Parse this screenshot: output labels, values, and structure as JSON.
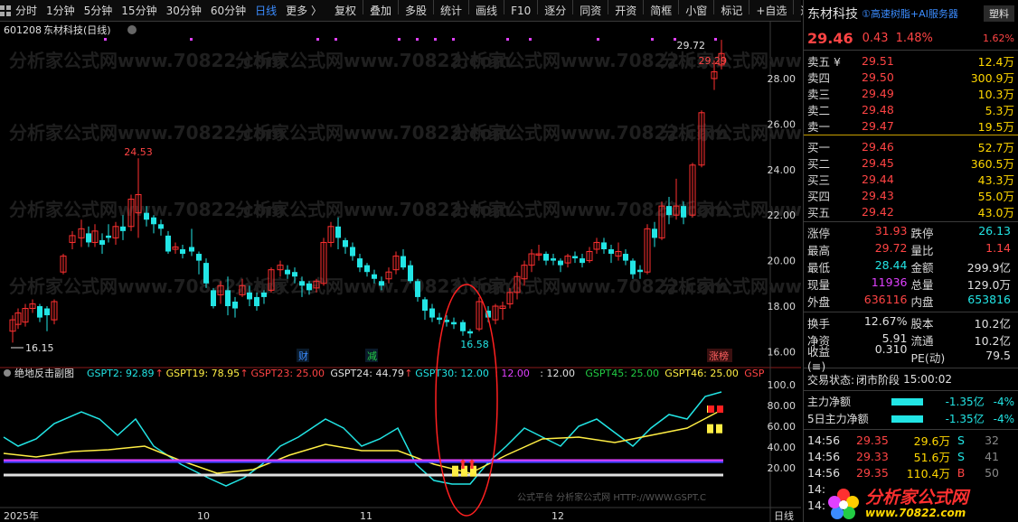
{
  "toolbar": {
    "items": [
      {
        "label": "分时",
        "active": false
      },
      {
        "label": "1分钟",
        "active": false
      },
      {
        "label": "5分钟",
        "active": false
      },
      {
        "label": "15分钟",
        "active": false
      },
      {
        "label": "30分钟",
        "active": false
      },
      {
        "label": "60分钟",
        "active": false
      },
      {
        "label": "日线",
        "active": true
      },
      {
        "label": "更多 〉",
        "active": false
      }
    ],
    "tools": [
      "复权",
      "叠加",
      "多股",
      "统计",
      "画线",
      "F10",
      "逐分",
      "同资",
      "开资",
      "简框",
      "小窗",
      "标记",
      "+自选",
      "返回"
    ]
  },
  "chart": {
    "header_code": "601208",
    "header_name": "东材科技(日线)",
    "watermark": "分析家公式网www.70822.com",
    "price_axis": [
      "28.00",
      "26.00",
      "24.00",
      "22.00",
      "20.00",
      "18.00",
      "16.00"
    ],
    "annotations": {
      "high_label": "29.72",
      "high2_label": "29.29",
      "peak_label": "24.53",
      "low_label": "16.15",
      "low2_label": "16.58"
    },
    "event_labels": [
      {
        "text": "财",
        "color": "#3b8cff"
      },
      {
        "text": "减",
        "color": "#22cc44"
      },
      {
        "text": "涨榜",
        "color": "#ff6060"
      }
    ],
    "date_axis": [
      "2025年",
      "10",
      "11",
      "12",
      "日线"
    ],
    "indicator": {
      "name": "绝地反击副图",
      "labels": [
        {
          "text": "GSPT2: 92.89",
          "color": "#22e5e5",
          "arrow": true
        },
        {
          "text": "GSPT19: 78.95",
          "color": "#ffee44",
          "arrow": true
        },
        {
          "text": "GSPT23: 25.00",
          "color": "#ff4444",
          "arrow": false
        },
        {
          "text": "GSPT24: 44.79",
          "color": "#e0e0e0",
          "arrow": true
        },
        {
          "text": "GSPT30: 12.00",
          "color": "#22e5e5",
          "arrow": false
        },
        {
          "text": ": 12.00",
          "color": "#e040ff",
          "arrow": false
        },
        {
          "text": ": 12.00",
          "color": "#e0e0e0",
          "arrow": false
        },
        {
          "text": "GSPT45: 25.00",
          "color": "#22cc44",
          "arrow": false
        },
        {
          "text": "GSPT46: 25.00",
          "color": "#ffee44",
          "arrow": false
        },
        {
          "text": "GSP",
          "color": "#ff4444",
          "arrow": false
        }
      ],
      "axis": [
        "100.0",
        "80.00",
        "60.00",
        "40.00",
        "20.00"
      ],
      "bottom_note": "公式平台 分析家公式网 HTTP://WWW.GSPT.C"
    }
  },
  "quote": {
    "name": "东材科技",
    "concept": "①高速树脂+AI服务器",
    "tag": "塑料",
    "price": "29.46",
    "change": "0.43",
    "pct": "1.48%",
    "ratio": "1.62%",
    "asks": [
      {
        "label": "卖五 ¥",
        "price": "29.51",
        "vol": "12.4万"
      },
      {
        "label": "卖四",
        "price": "29.50",
        "vol": "300.9万"
      },
      {
        "label": "卖三",
        "price": "29.49",
        "vol": "10.3万"
      },
      {
        "label": "卖二",
        "price": "29.48",
        "vol": "5.3万"
      },
      {
        "label": "卖一",
        "price": "29.47",
        "vol": "19.5万"
      }
    ],
    "bids": [
      {
        "label": "买一",
        "price": "29.46",
        "vol": "52.7万"
      },
      {
        "label": "买二",
        "price": "29.45",
        "vol": "360.5万"
      },
      {
        "label": "买三",
        "price": "29.44",
        "vol": "43.3万"
      },
      {
        "label": "买四",
        "price": "29.43",
        "vol": "55.0万"
      },
      {
        "label": "买五",
        "price": "29.42",
        "vol": "43.0万"
      }
    ],
    "stats": [
      [
        {
          "k": "涨停",
          "v": "31.93",
          "c": "red"
        },
        {
          "k": "跌停",
          "v": "26.13",
          "c": "cyan"
        }
      ],
      [
        {
          "k": "最高",
          "v": "29.72",
          "c": "red"
        },
        {
          "k": "量比",
          "v": "1.14",
          "c": "red"
        }
      ],
      [
        {
          "k": "最低",
          "v": "28.44",
          "c": "cyan"
        },
        {
          "k": "金额",
          "v": "299.9亿",
          "c": "white"
        }
      ],
      [
        {
          "k": "现量",
          "v": "11936",
          "c": "magenta"
        },
        {
          "k": "总量",
          "v": "129.0万",
          "c": "white"
        }
      ],
      [
        {
          "k": "外盘",
          "v": "636116",
          "c": "red"
        },
        {
          "k": "内盘",
          "v": "653816",
          "c": "cyan"
        }
      ]
    ],
    "stats2": [
      [
        {
          "k": "换手",
          "v": "12.67%",
          "c": "white"
        },
        {
          "k": "股本",
          "v": "10.2亿",
          "c": "white"
        }
      ],
      [
        {
          "k": "净资",
          "v": "5.91",
          "c": "white"
        },
        {
          "k": "流通",
          "v": "10.2亿",
          "c": "white"
        }
      ],
      [
        {
          "k": "收益(≡)",
          "v": "0.310",
          "c": "white"
        },
        {
          "k": "PE(动)",
          "v": "79.5",
          "c": "white"
        }
      ]
    ],
    "status": {
      "label": "交易状态:",
      "value": "闭市阶段",
      "time": "15:00:02"
    },
    "flows": [
      {
        "label": "主力净额",
        "value": "-1.35亿",
        "pct": "-4%"
      },
      {
        "label": "5日主力净额",
        "value": "-1.35亿",
        "pct": "-4%"
      }
    ],
    "ticks": [
      {
        "t": "14:56",
        "p": "29.35",
        "v": "29.6万",
        "s": "S",
        "n": "32"
      },
      {
        "t": "14:56",
        "p": "29.33",
        "v": "51.6万",
        "s": "S",
        "n": "41"
      },
      {
        "t": "14:56",
        "p": "29.35",
        "v": "110.4万",
        "s": "B",
        "n": "50"
      },
      {
        "t": "14:",
        "p": "",
        "v": "",
        "s": "",
        "n": ""
      },
      {
        "t": "14:",
        "p": "",
        "v": "",
        "s": "",
        "n": ""
      }
    ],
    "logo": {
      "main": "分析家公式网",
      "url": "www.70822.com"
    }
  }
}
